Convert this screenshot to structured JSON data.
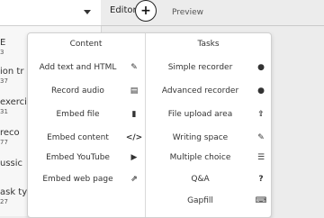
{
  "left_list": {
    "items": [
      {
        "title": "E",
        "sub": "3"
      },
      {
        "title": "ion tr",
        "sub": "37"
      },
      {
        "title": "exerci",
        "sub": "31"
      },
      {
        "title": "reco",
        "sub": "77"
      },
      {
        "title": "ussic",
        "sub": ""
      },
      {
        "title": "ask ty",
        "sub": "27"
      }
    ]
  },
  "tabs": {
    "editor": "Editor",
    "add_symbol": "+",
    "preview": "Preview"
  },
  "menu": {
    "content_title": "Content",
    "tasks_title": "Tasks",
    "content_items": [
      {
        "label": "Add text and HTML",
        "icon": "edit-icon",
        "glyph": "✎"
      },
      {
        "label": "Record audio",
        "icon": "document-icon",
        "glyph": "▤"
      },
      {
        "label": "Embed file",
        "icon": "file-icon",
        "glyph": "▮"
      },
      {
        "label": "Embed content",
        "icon": "code-icon",
        "glyph": "</>"
      },
      {
        "label": "Embed YouTube",
        "icon": "youtube-icon",
        "glyph": "▶"
      },
      {
        "label": "Embed web page",
        "icon": "external-link-icon",
        "glyph": "⇗"
      }
    ],
    "task_items": [
      {
        "label": "Simple recorder",
        "icon": "microphone-icon",
        "glyph": "🎙"
      },
      {
        "label": "Advanced recorder",
        "icon": "microphone-icon",
        "glyph": "🎙"
      },
      {
        "label": "File upload area",
        "icon": "upload-icon",
        "glyph": "⇪"
      },
      {
        "label": "Writing space",
        "icon": "pencil-icon",
        "glyph": "✎"
      },
      {
        "label": "Multiple choice",
        "icon": "list-icon",
        "glyph": "☰"
      },
      {
        "label": "Q&A",
        "icon": "question-icon",
        "glyph": "?"
      },
      {
        "label": "Gapfill",
        "icon": "keyboard-icon",
        "glyph": "⌨"
      }
    ]
  }
}
